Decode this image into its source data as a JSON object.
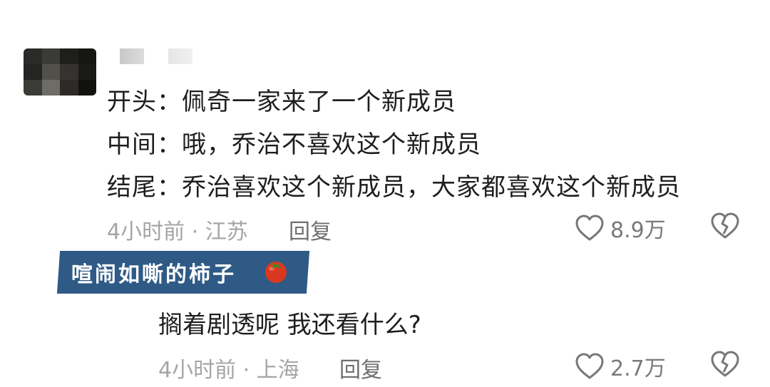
{
  "comment": {
    "lines": [
      "开头：佩奇一家来了一个新成员",
      "中间：哦，乔治不喜欢这个新成员",
      "结尾：乔治喜欢这个新成员，大家都喜欢这个新成员"
    ],
    "meta": "4小时前 · 江苏",
    "reply_label": "回复",
    "likes": "8.9万",
    "like_icon": "heart-outline-icon",
    "dislike_icon": "broken-heart-icon"
  },
  "reply": {
    "nickname": "喧闹如嘶的柿子",
    "nickname_emoji": "tomato-icon",
    "text": "搁着剧透呢 我还看什么?",
    "meta": "4小时前 · 上海",
    "reply_label": "回复",
    "likes": "2.7万",
    "like_icon": "heart-outline-icon",
    "dislike_icon": "broken-heart-icon"
  }
}
